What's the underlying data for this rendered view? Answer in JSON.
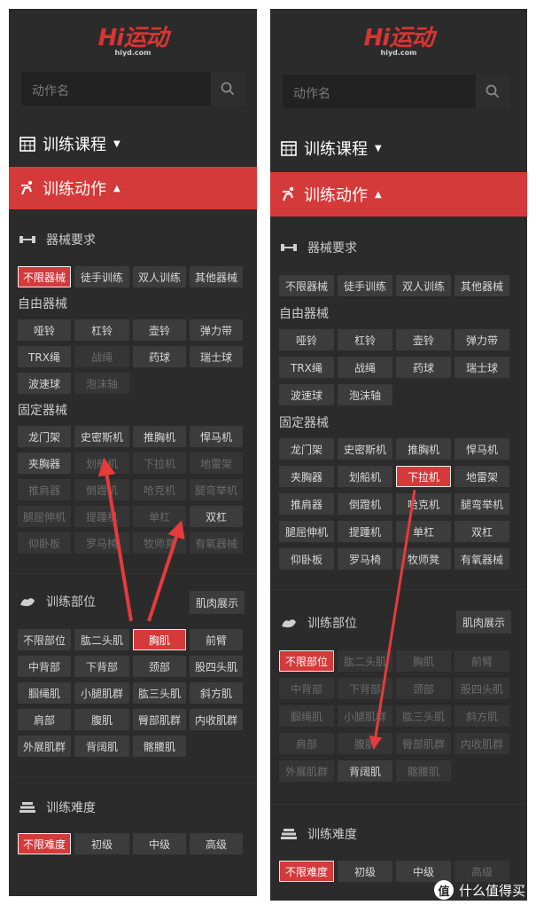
{
  "logo_text": "Hi运动",
  "logo_sub": "hiyd.com",
  "search_placeholder": "动作名",
  "nav": {
    "courses": "训练课程",
    "actions": "训练动作"
  },
  "equipment": {
    "title": "器械要求",
    "top": [
      "不限器械",
      "徒手训练",
      "双人训练",
      "其他器械"
    ],
    "free_title": "自由器械",
    "free": [
      "哑铃",
      "杠铃",
      "壶铃",
      "弹力带",
      "TRX绳",
      "战绳",
      "药球",
      "瑞士球",
      "波速球",
      "泡沫轴"
    ],
    "fixed_title": "固定器械",
    "fixed": [
      "龙门架",
      "史密斯机",
      "推胸机",
      "悍马机",
      "夹胸器",
      "划船机",
      "下拉机",
      "地雷架",
      "推肩器",
      "倒蹬机",
      "哈克机",
      "腿弯举机",
      "腿屈伸机",
      "提踵机",
      "单杠",
      "双杠",
      "仰卧板",
      "罗马椅",
      "牧师凳",
      "有氧器械"
    ]
  },
  "body": {
    "title": "训练部位",
    "muscle_btn": "肌肉展示",
    "parts": [
      "不限部位",
      "肱二头肌",
      "胸肌",
      "前臂",
      "中背部",
      "下背部",
      "颈部",
      "股四头肌",
      "腘绳肌",
      "小腿肌群",
      "肱三头肌",
      "斜方肌",
      "肩部",
      "腹肌",
      "臀部肌群",
      "内收肌群",
      "外展肌群",
      "背阔肌",
      "髂腰肌"
    ]
  },
  "difficulty": {
    "title": "训练难度",
    "levels": [
      "不限难度",
      "初级",
      "中级",
      "高级"
    ]
  },
  "watermark": "什么值得买",
  "watermark_icon": "值",
  "colors": {
    "accent": "#d53a3a",
    "panel": "#2b2b2b",
    "chip": "#3c3c3c"
  }
}
